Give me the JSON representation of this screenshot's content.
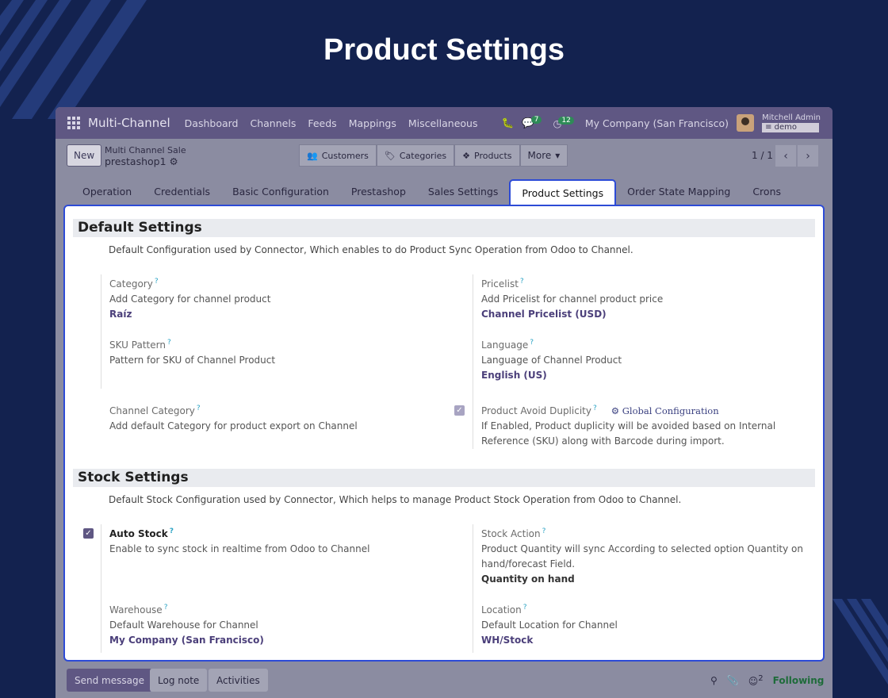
{
  "page_title": "Product Settings",
  "navbar": {
    "app_name": "Multi-Channel",
    "menu": [
      "Dashboard",
      "Channels",
      "Feeds",
      "Mappings",
      "Miscellaneous"
    ],
    "messages_count": "7",
    "activities_count": "12",
    "company": "My Company (San Francisco)",
    "user_name": "Mitchell Admin",
    "database": "demo"
  },
  "control_panel": {
    "new_label": "New",
    "breadcrumb_parent": "Multi Channel Sale",
    "breadcrumb_current": "prestashop1",
    "smart_buttons": [
      "Customers",
      "Categories",
      "Products",
      "More"
    ],
    "pager": "1 / 1"
  },
  "tabs": [
    "Operation",
    "Credentials",
    "Basic Configuration",
    "Prestashop",
    "Sales Settings",
    "Product Settings",
    "Order State Mapping",
    "Crons"
  ],
  "default_settings": {
    "title": "Default Settings",
    "description": "Default Configuration used by Connector, Which enables to do Product Sync Operation from Odoo to Channel.",
    "category": {
      "label": "Category",
      "help": "Add Category for channel product",
      "value": "Raíz"
    },
    "pricelist": {
      "label": "Pricelist",
      "help": "Add Pricelist for channel product price",
      "value": "Channel Pricelist (USD)"
    },
    "sku_pattern": {
      "label": "SKU Pattern",
      "help": "Pattern for SKU of Channel Product"
    },
    "language": {
      "label": "Language",
      "help": "Language of Channel Product",
      "value": "English (US)"
    },
    "channel_category": {
      "label": "Channel Category",
      "help": "Add default Category for product export on Channel"
    },
    "avoid_duplicity": {
      "label": "Product Avoid Duplicity",
      "link": "Global Configuration",
      "help_line1": "If Enabled, Product duplicity will be avoided based on Internal",
      "help_line2": "Reference (SKU) along with Barcode during import.",
      "checked": true
    }
  },
  "stock_settings": {
    "title": "Stock Settings",
    "description": "Default Stock Configuration used by Connector, Which helps to manage Product Stock Operation from Odoo to Channel.",
    "auto_stock": {
      "label": "Auto Stock",
      "help": "Enable to sync stock in realtime from Odoo to Channel",
      "checked": true
    },
    "stock_action": {
      "label": "Stock Action",
      "help_line1": "Product Quantity will sync According to selected option Quantity on",
      "help_line2": "hand/forecast Field.",
      "value": "Quantity on hand"
    },
    "warehouse": {
      "label": "Warehouse",
      "help": "Default Warehouse for Channel",
      "value": "My Company (San Francisco)"
    },
    "location": {
      "label": "Location",
      "help": "Default Location for Channel",
      "value": "WH/Stock"
    }
  },
  "chatter": {
    "send_message": "Send message",
    "log_note": "Log note",
    "activities": "Activities",
    "followers_count": "2",
    "following": "Following"
  },
  "colors": {
    "background": "#13224f",
    "navbar": "#5f5783",
    "highlight": "#2d4bd6",
    "value_text": "#4b3f7a",
    "checkbox": "#5f5783"
  }
}
